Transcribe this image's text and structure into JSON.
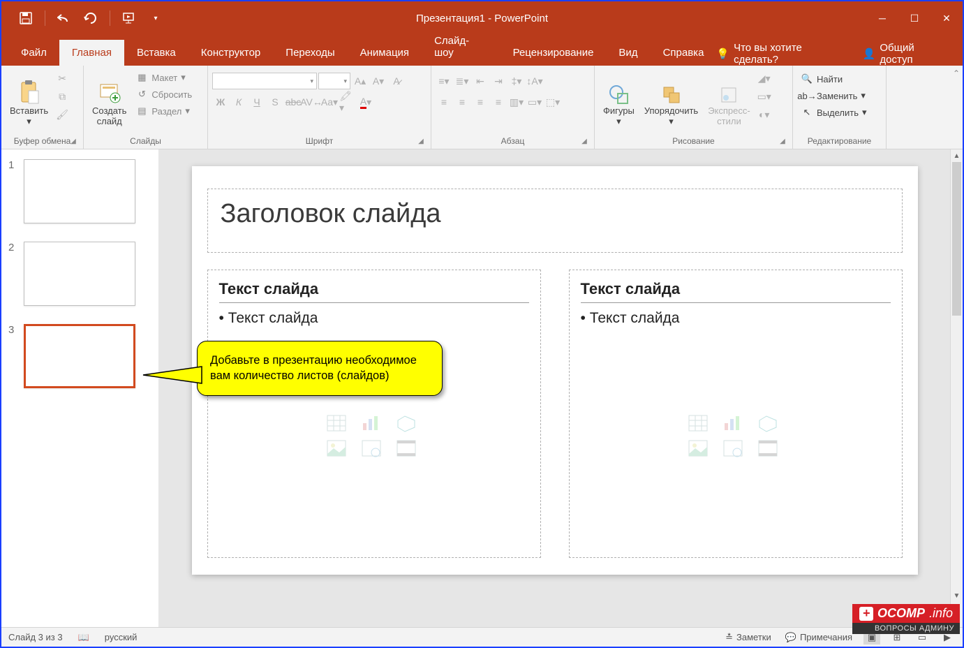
{
  "title": "Презентация1 - PowerPoint",
  "qat": {
    "save": "save",
    "undo": "undo",
    "redo": "redo",
    "start": "start"
  },
  "tabs": [
    "Файл",
    "Главная",
    "Вставка",
    "Конструктор",
    "Переходы",
    "Анимация",
    "Слайд-шоу",
    "Рецензирование",
    "Вид",
    "Справка"
  ],
  "active_tab": 1,
  "tell_me": "Что вы хотите сделать?",
  "share": "Общий доступ",
  "ribbon": {
    "clipboard": {
      "label": "Буфер обмена",
      "paste": "Вставить"
    },
    "slides": {
      "label": "Слайды",
      "new": "Создать\nслайд",
      "layout": "Макет",
      "reset": "Сбросить",
      "section": "Раздел"
    },
    "font": {
      "label": "Шрифт"
    },
    "paragraph": {
      "label": "Абзац"
    },
    "drawing": {
      "label": "Рисование",
      "shapes": "Фигуры",
      "arrange": "Упорядочить",
      "quick": "Экспресс-\nстили"
    },
    "editing": {
      "label": "Редактирование",
      "find": "Найти",
      "replace": "Заменить",
      "select": "Выделить"
    }
  },
  "thumbs": [
    {
      "n": "1"
    },
    {
      "n": "2"
    },
    {
      "n": "3"
    }
  ],
  "selected_thumb": 2,
  "slide": {
    "title": "Заголовок слайда",
    "left_head": "Текст слайда",
    "left_bullet": "Текст слайда",
    "right_head": "Текст слайда",
    "right_bullet": "Текст слайда"
  },
  "callout": "Добавьте в презентацию необходимое вам количество листов (слайдов)",
  "status": {
    "slide": "Слайд 3 из 3",
    "lang": "русский",
    "notes": "Заметки",
    "comments": "Примечания"
  },
  "watermark": {
    "brand": "OCOMP",
    "tld": ".info",
    "sub": "ВОПРОСЫ АДМИНУ"
  }
}
